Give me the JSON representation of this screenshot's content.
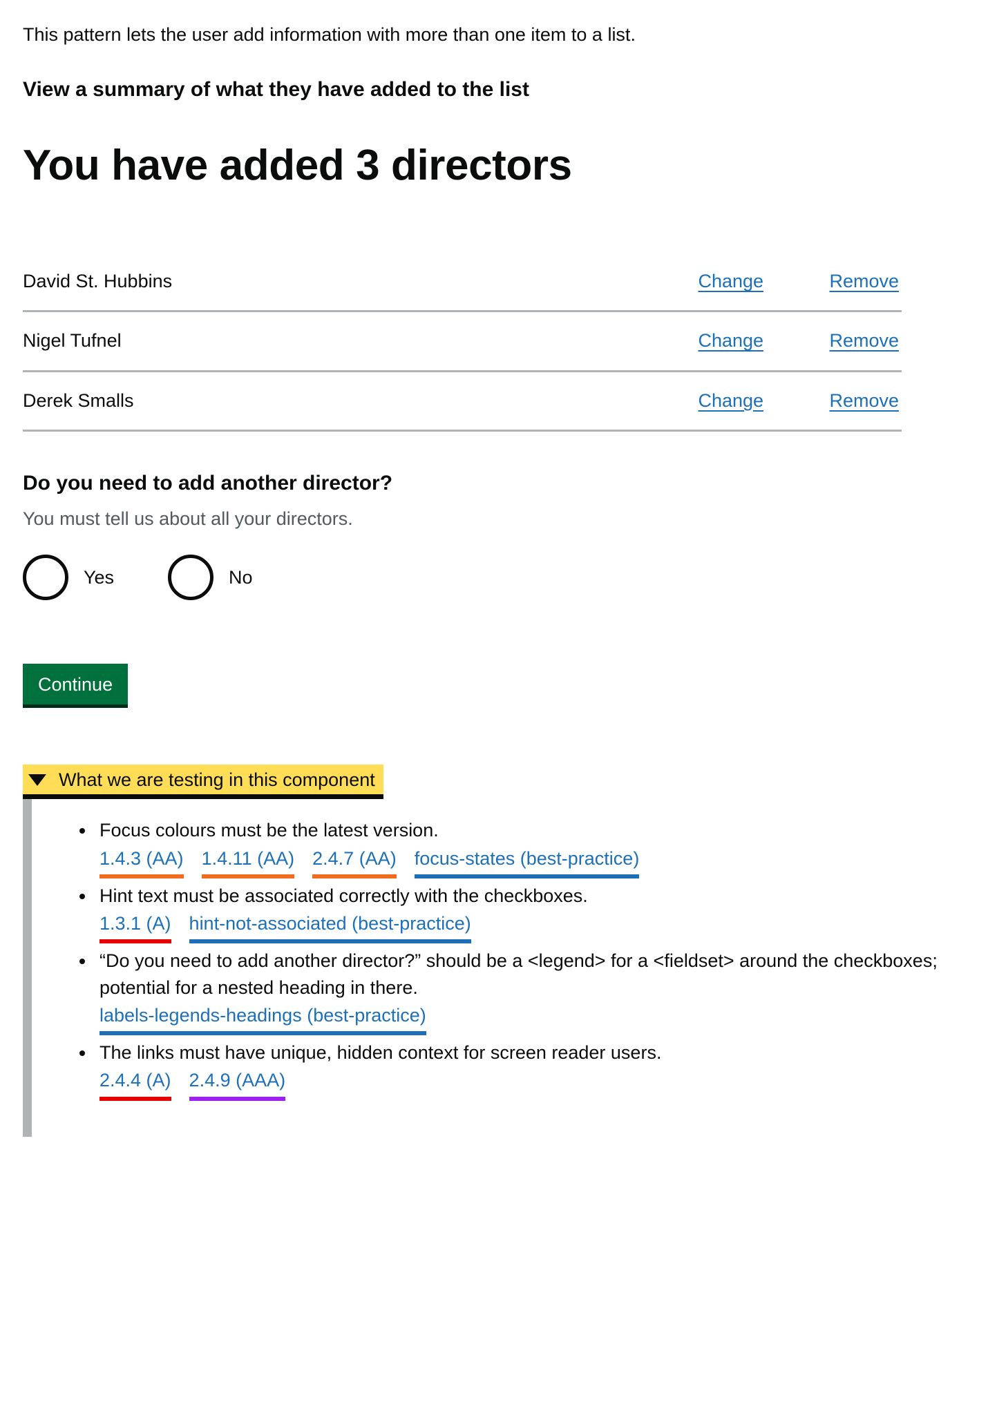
{
  "intro": {
    "paragraph": "This pattern lets the user add information with more than one item to a list.",
    "section_heading": "View a summary of what they have added to the list"
  },
  "page_title": "You have added 3 directors",
  "summary_list": {
    "change_label": "Change",
    "remove_label": "Remove",
    "rows": [
      {
        "name": "David St. Hubbins"
      },
      {
        "name": "Nigel Tufnel"
      },
      {
        "name": "Derek Smalls"
      }
    ]
  },
  "question": {
    "legend": "Do you need to add another director?",
    "hint": "You must tell us about all your directors.",
    "options": [
      {
        "label": "Yes",
        "selected": false
      },
      {
        "label": "No",
        "selected": false
      }
    ]
  },
  "actions": {
    "continue_label": "Continue"
  },
  "details": {
    "summary_label": "What we are testing in this component",
    "expanded": true,
    "items": [
      {
        "text": "Focus colours must be the latest version.",
        "criteria": [
          {
            "label": "1.4.3 (AA)",
            "level": "aa"
          },
          {
            "label": "1.4.11 (AA)",
            "level": "aa"
          },
          {
            "label": "2.4.7 (AA)",
            "level": "aa"
          },
          {
            "label": "focus-states (best-practice)",
            "level": "bp"
          }
        ]
      },
      {
        "text": "Hint text must be associated correctly with the checkboxes.",
        "criteria": [
          {
            "label": "1.3.1 (A)",
            "level": "a"
          },
          {
            "label": "hint-not-associated (best-practice)",
            "level": "bp"
          }
        ]
      },
      {
        "text": "“Do you need to add another director?” should be a <legend> for a <fieldset> around the checkboxes; potential for a nested heading in there.",
        "criteria": [
          {
            "label": "labels-legends-headings (best-practice)",
            "level": "bp"
          }
        ]
      },
      {
        "text": "The links must have unique, hidden context for screen reader users.",
        "criteria": [
          {
            "label": "2.4.4 (A)",
            "level": "a"
          },
          {
            "label": "2.4.9 (AAA)",
            "level": "aaa"
          }
        ]
      }
    ]
  },
  "colors": {
    "link": "#1d70b8",
    "button_green": "#00703c",
    "button_shadow": "#002d18",
    "hint_grey": "#505a5f",
    "rule_grey": "#b1b4b6",
    "summary_yellow": "#ffdd57",
    "level_a": "#e60000",
    "level_aa": "#f26c1f",
    "level_aaa": "#a020f0",
    "level_bp": "#1d70b8"
  }
}
